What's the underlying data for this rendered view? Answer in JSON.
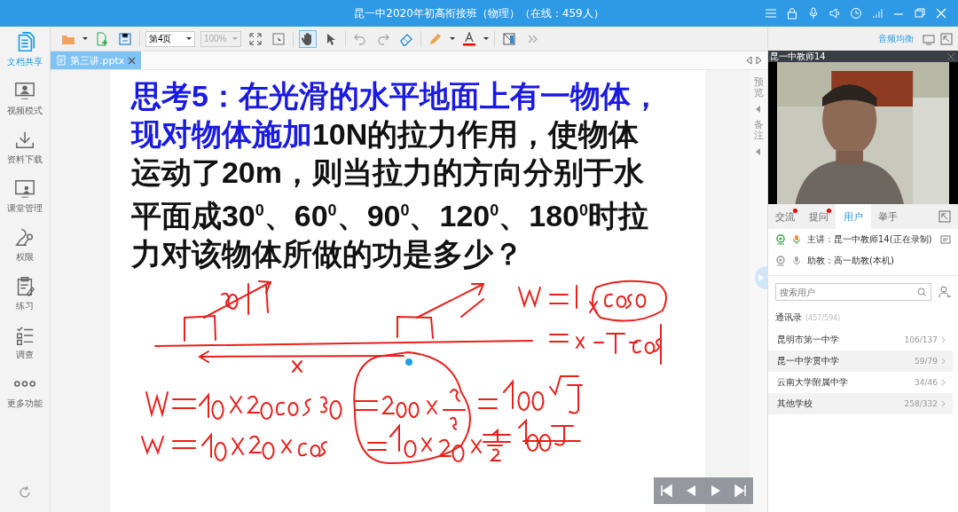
{
  "window": {
    "title": "昆一中2020年初高衔接班（物理）（在线：459人）"
  },
  "sidebar": {
    "items": [
      {
        "label": "文档共享",
        "selected": true
      },
      {
        "label": "视频模式",
        "selected": false
      },
      {
        "label": "资料下载",
        "selected": false
      },
      {
        "label": "课堂管理",
        "selected": false
      },
      {
        "label": "权限",
        "selected": false
      },
      {
        "label": "练习",
        "selected": false
      },
      {
        "label": "调查",
        "selected": false
      },
      {
        "label": "更多功能",
        "selected": false
      }
    ]
  },
  "toolbar": {
    "page_select": "第4页",
    "zoom_select": {
      "value": "100%",
      "disabled": true
    },
    "hand_tool": {
      "selected": true
    }
  },
  "document_tabs": [
    {
      "label": "第三讲.pptx",
      "selected": true
    }
  ],
  "slide": {
    "question_lead": "思考5：在光滑的水平地面上有一物体，现对物体施加",
    "question_body": "10N的拉力作用，使物体运动了20m，则当拉力的方向分别于水平面成30$^{0}$、60$^{0}$、90$^{0}$、120$^{0}$、180$^{0}$时拉力对该物体所做的功是多少？"
  },
  "side_tabs": [
    {
      "label": "预览"
    },
    {
      "label": "备注"
    }
  ],
  "right_panel": {
    "audio_link": "音频均衡",
    "video": {
      "name": "昆一中教师14"
    },
    "tabs": [
      {
        "label": "交流",
        "selected": false,
        "unread": true
      },
      {
        "label": "提问",
        "selected": false,
        "unread": true
      },
      {
        "label": "用户",
        "selected": true,
        "unread": false
      },
      {
        "label": "举手",
        "selected": false,
        "unread": false
      }
    ],
    "hosts": [
      {
        "role": "主讲：",
        "name": "昆一中教师14(正在录制)",
        "active": true
      },
      {
        "role": "助教：",
        "name": "高一助教(本机)",
        "active": false
      }
    ],
    "search": {
      "placeholder": "搜索用户"
    },
    "contacts": {
      "title": "通讯录",
      "count": "(457/594)",
      "groups": [
        {
          "name": "昆明市第一中学",
          "count": "106/137"
        },
        {
          "name": "昆一中学贯中学",
          "count": "59/79"
        },
        {
          "name": "云南大学附属中学",
          "count": "34/46"
        },
        {
          "name": "其他学校",
          "count": "258/332"
        }
      ]
    }
  }
}
